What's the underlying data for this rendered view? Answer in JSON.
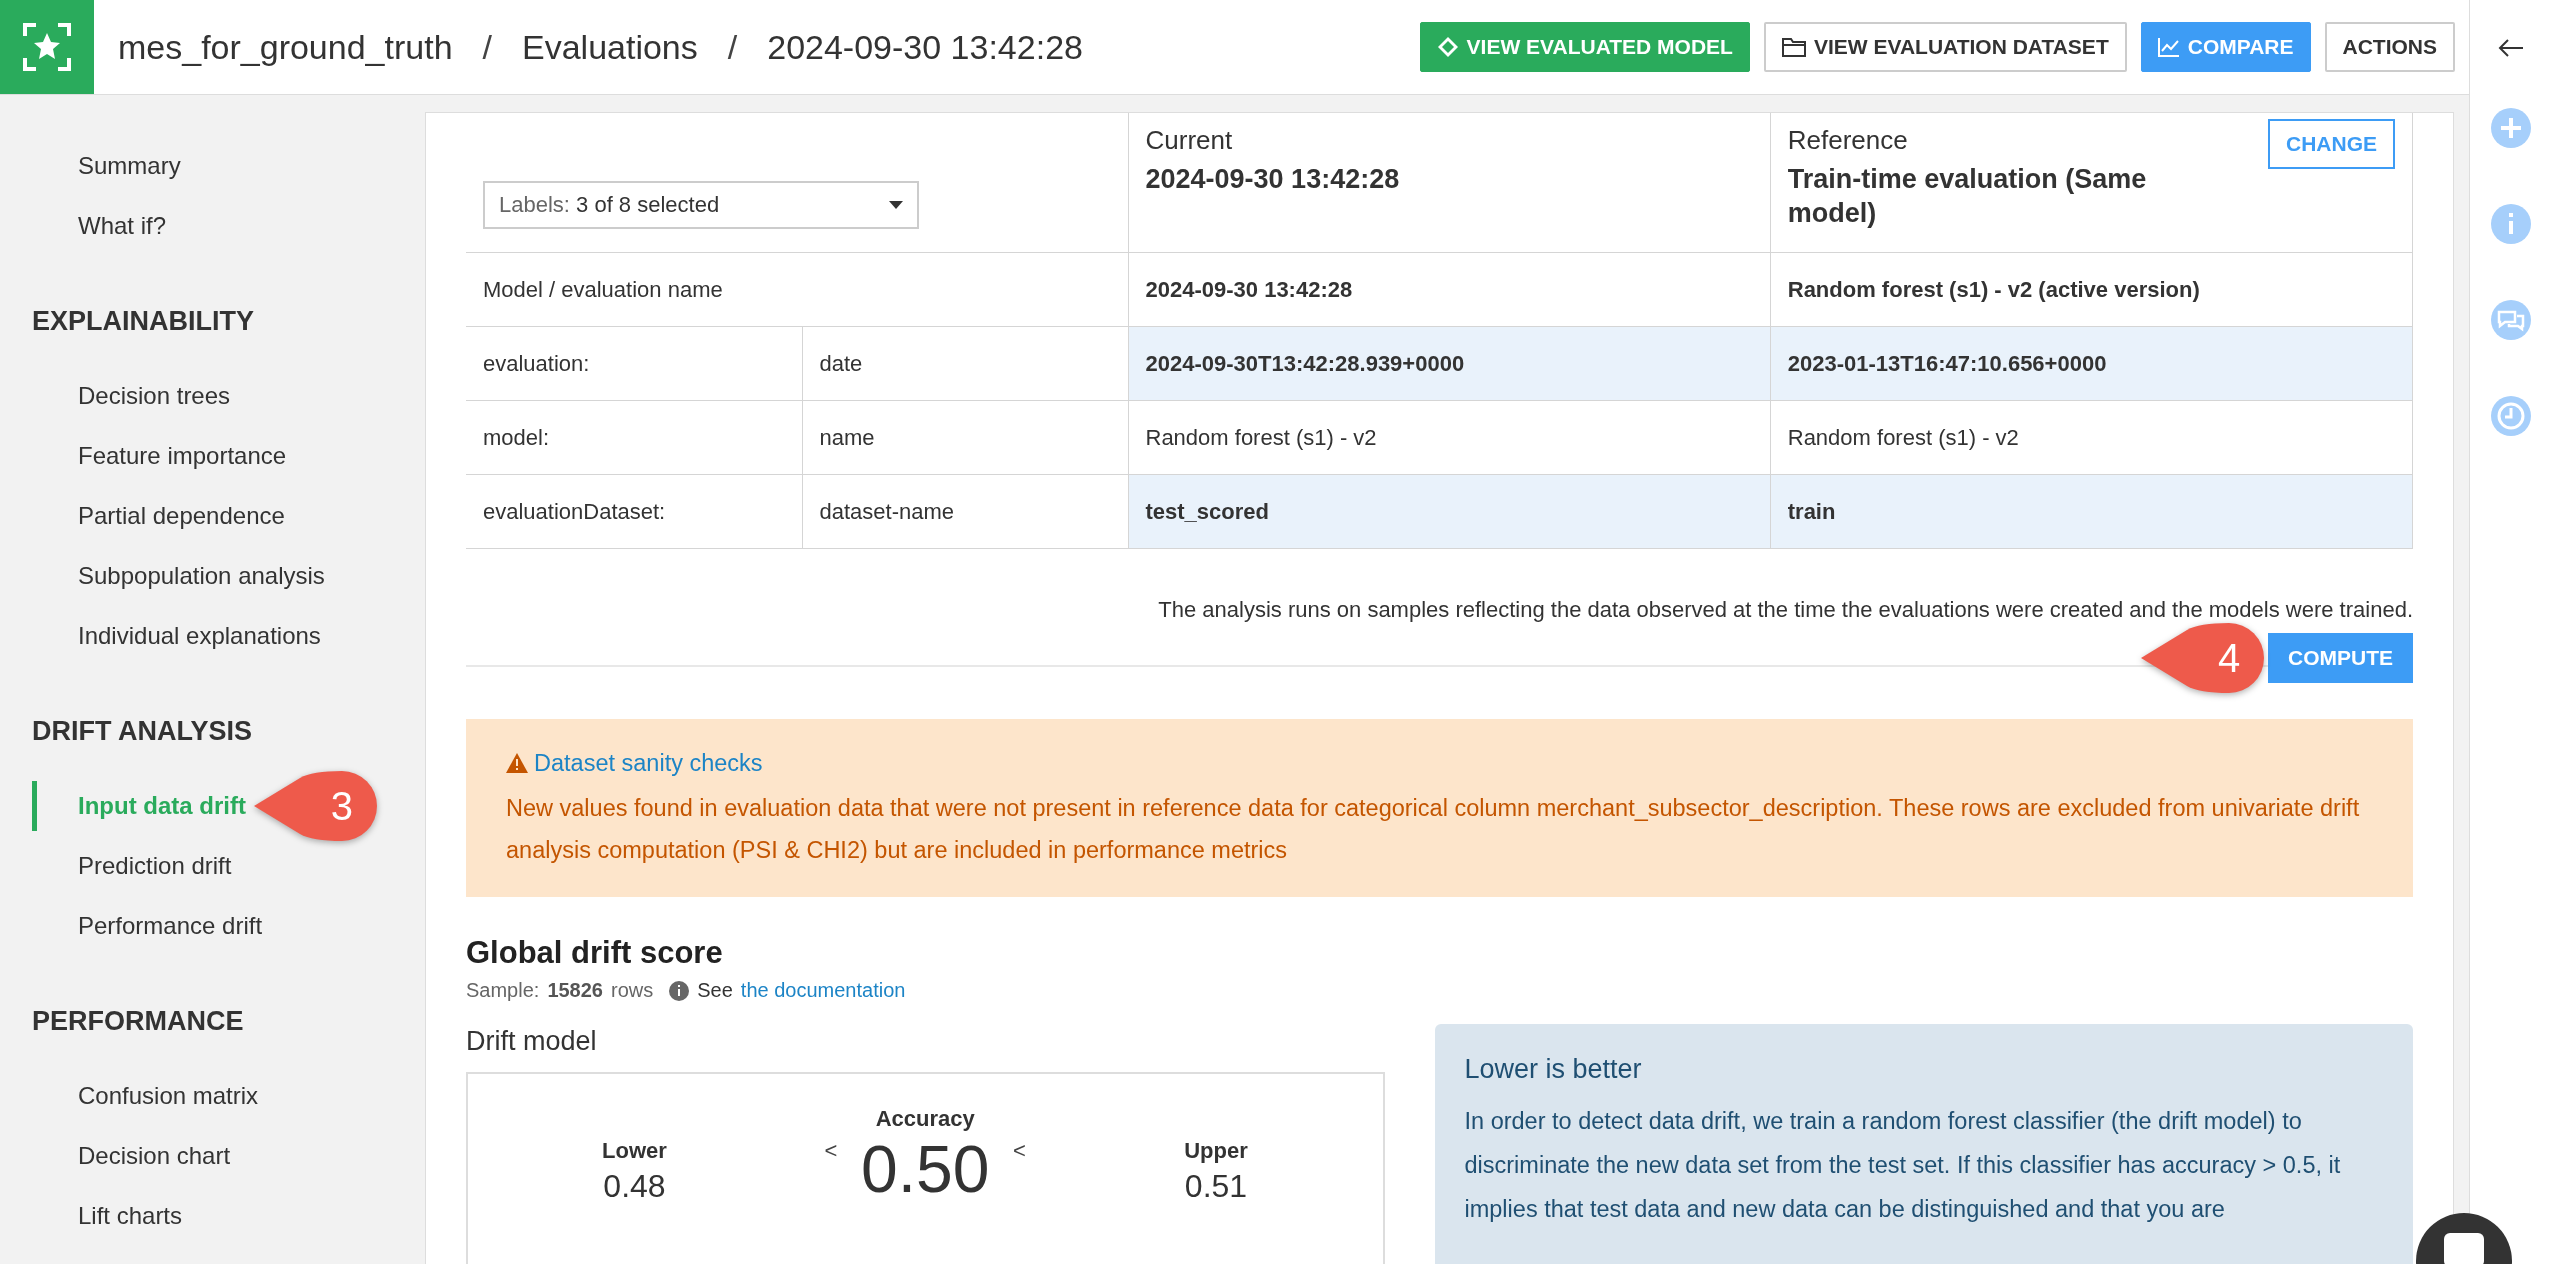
{
  "header": {
    "breadcrumb": [
      "mes_for_ground_truth",
      "Evaluations",
      "2024-09-30 13:42:28"
    ],
    "breadcrumb_separator": "/",
    "buttons": [
      {
        "label": "VIEW EVALUATED MODEL",
        "kind": "success"
      },
      {
        "label": "VIEW EVALUATION DATASET",
        "kind": "outline"
      },
      {
        "label": "COMPARE",
        "kind": "primary"
      },
      {
        "label": "ACTIONS",
        "kind": "plain"
      }
    ]
  },
  "sidebar": {
    "sections": [
      {
        "items": [
          {
            "label": "Summary",
            "selected": false
          },
          {
            "label": "What if?",
            "selected": false
          }
        ]
      },
      {
        "title": "EXPLAINABILITY",
        "items": [
          {
            "label": "Decision trees",
            "selected": false
          },
          {
            "label": "Feature importance",
            "selected": false
          },
          {
            "label": "Partial dependence",
            "selected": false
          },
          {
            "label": "Subpopulation analysis",
            "selected": false
          },
          {
            "label": "Individual explanations",
            "selected": false
          }
        ]
      },
      {
        "title": "DRIFT ANALYSIS",
        "items": [
          {
            "label": "Input data drift",
            "selected": true,
            "callout": "3"
          },
          {
            "label": "Prediction drift",
            "selected": false
          },
          {
            "label": "Performance drift",
            "selected": false
          }
        ]
      },
      {
        "title": "PERFORMANCE",
        "items": [
          {
            "label": "Confusion matrix",
            "selected": false
          },
          {
            "label": "Decision chart",
            "selected": false
          },
          {
            "label": "Lift charts",
            "selected": false
          }
        ]
      }
    ]
  },
  "comparison": {
    "labels_dropdown": {
      "label": "Labels:",
      "value": "3 of 8 selected"
    },
    "columns": [
      {
        "caption": "Current",
        "title": "2024-09-30 13:42:28"
      },
      {
        "caption": "Reference",
        "title": "Train-time evaluation (Same model)",
        "action": "CHANGE"
      }
    ],
    "rows": [
      {
        "key": "Model / evaluation name",
        "current": "2024-09-30 13:42:28",
        "reference": "Random forest (s1) - v2 (active version)",
        "bold": true,
        "highlighted": false
      },
      {
        "key": "evaluation:",
        "subkey": "date",
        "current": "2024-09-30T13:42:28.939+0000",
        "reference": "2023-01-13T16:47:10.656+0000",
        "bold": true,
        "highlighted": true
      },
      {
        "key": "model:",
        "subkey": "name",
        "current": "Random forest (s1) - v2",
        "reference": "Random forest (s1) - v2",
        "bold": false,
        "highlighted": false
      },
      {
        "key": "evaluationDataset:",
        "subkey": "dataset-name",
        "current": "test_scored",
        "reference": "train",
        "bold": true,
        "highlighted": true
      }
    ],
    "note": "The analysis runs on samples reflecting the data observed at the time the evaluations were created and the models were trained.",
    "compute": {
      "label": "COMPUTE",
      "callout": "4"
    }
  },
  "warning": {
    "title": "Dataset sanity checks",
    "message": "New values found in evaluation data that were not present in reference data for categorical column merchant_subsector_description. These rows are excluded from univariate drift analysis computation (PSI & CHI2) but are included in performance metrics"
  },
  "global_drift": {
    "title": "Global drift score",
    "sample_label": "Sample:",
    "sample_count": "15826",
    "sample_unit": "rows",
    "see": "See",
    "link": "the documentation",
    "drift_model": {
      "title": "Drift model",
      "metric": "Accuracy",
      "value": "0.50",
      "lower_label": "Lower",
      "lower": "0.48",
      "upper_label": "Upper",
      "upper": "0.51",
      "separators": [
        "<",
        "<"
      ]
    },
    "info": {
      "title": "Lower is better",
      "text": "In order to detect data drift, we train a random forest classifier (the drift model) to discriminate the new data set from the test set. If this classifier has accuracy > 0.5, it implies that test data and new data can be distinguished and that you are"
    }
  }
}
